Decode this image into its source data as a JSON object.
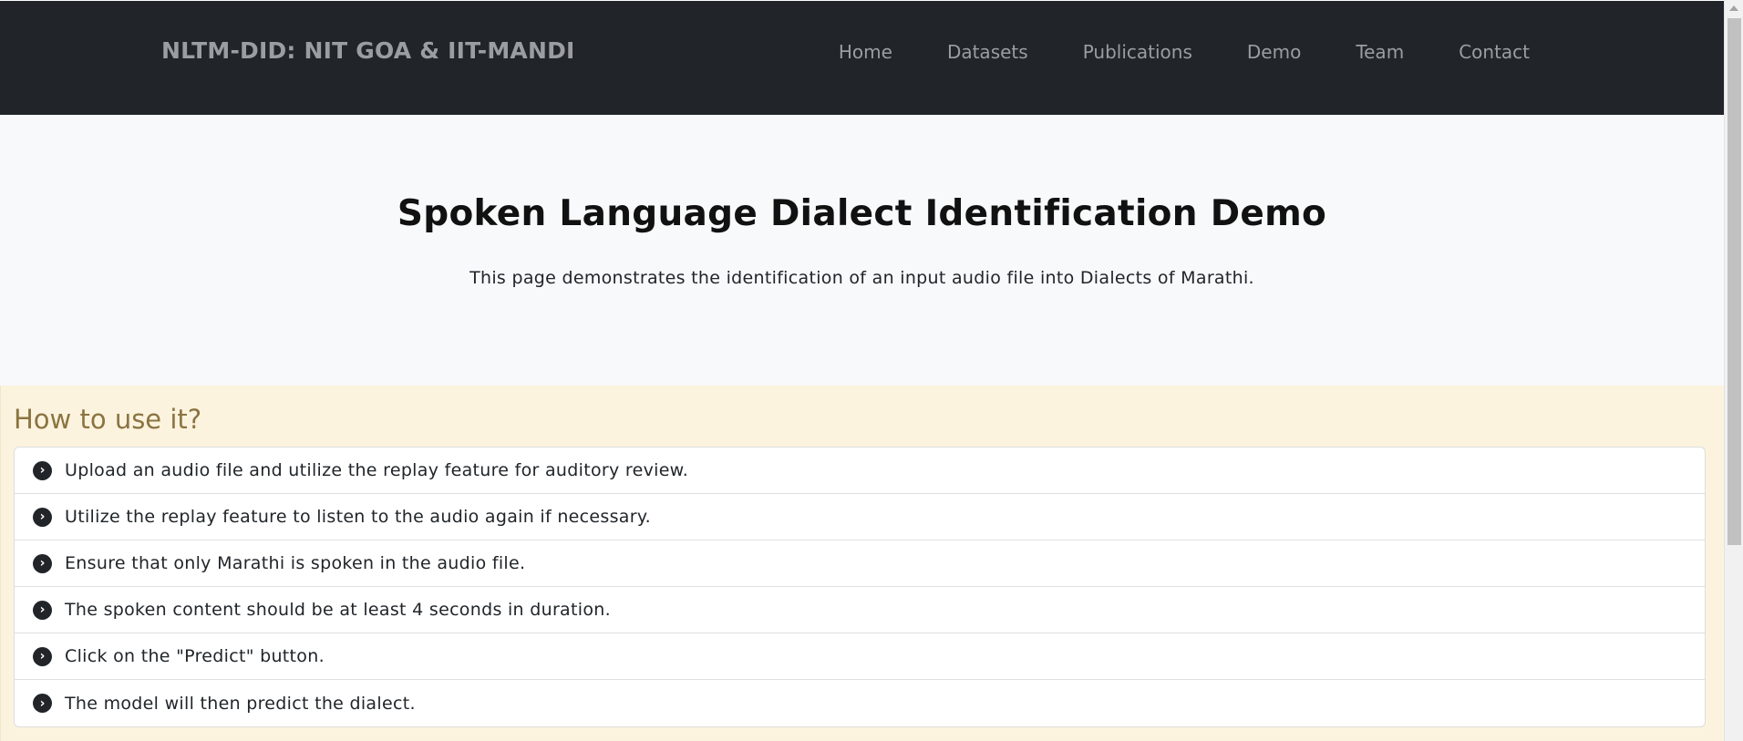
{
  "navbar": {
    "brand": "NLTM-DID: NIT GOA & IIT-MANDI",
    "links": [
      "Home",
      "Datasets",
      "Publications",
      "Demo",
      "Team",
      "Contact"
    ]
  },
  "hero": {
    "title": "Spoken Language Dialect Identification Demo",
    "subtitle": "This page demonstrates the identification of an input audio file into Dialects of Marathi."
  },
  "howto": {
    "heading": "How to use it?",
    "icon": "chevron-circle-right-icon",
    "steps": [
      "Upload an audio file and utilize the replay feature for auditory review.",
      "Utilize the replay feature to listen to the audio again if necessary.",
      "Ensure that only Marathi is spoken in the audio file.",
      "The spoken content should be at least 4 seconds in duration.",
      "Click on the \"Predict\" button.",
      "The model will then predict the dialect."
    ]
  },
  "colors": {
    "navbar_bg": "#212529",
    "hero_bg": "#f8f9fa",
    "howto_bg": "#fcf3df",
    "howto_heading": "#8a7440"
  }
}
